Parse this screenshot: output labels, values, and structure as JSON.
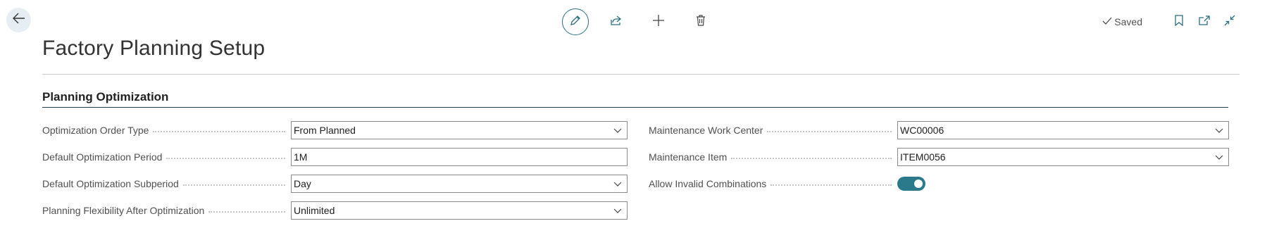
{
  "header": {
    "back_label": "Back",
    "saved_label": "Saved",
    "page_title": "Factory Planning Setup"
  },
  "section": {
    "title": "Planning Optimization"
  },
  "left_fields": [
    {
      "label": "Optimization Order Type",
      "value": "From Planned",
      "type": "dropdown"
    },
    {
      "label": "Default Optimization Period",
      "value": "1M",
      "type": "text"
    },
    {
      "label": "Default Optimization Subperiod",
      "value": "Day",
      "type": "dropdown"
    },
    {
      "label": "Planning Flexibility After Optimization",
      "value": "Unlimited",
      "type": "dropdown"
    }
  ],
  "right_fields": [
    {
      "label": "Maintenance Work Center",
      "value": "WC00006",
      "type": "dropdown"
    },
    {
      "label": "Maintenance Item",
      "value": "ITEM0056",
      "type": "dropdown"
    },
    {
      "label": "Allow Invalid Combinations",
      "value": "on",
      "type": "toggle"
    }
  ],
  "colors": {
    "accent": "#2a7a8c",
    "section_rule": "#1e3a4f"
  }
}
